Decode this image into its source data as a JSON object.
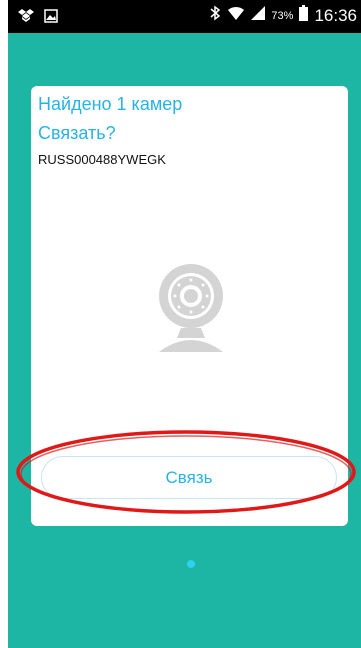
{
  "status_bar": {
    "battery_percent": "73%",
    "time": "16:36",
    "icons": [
      "dropbox-icon",
      "image-notification-icon",
      "bluetooth-icon",
      "wifi-icon",
      "signal-icon",
      "battery-icon"
    ]
  },
  "card": {
    "title_line1": "Найдено 1 камер",
    "title_line2": "Связать?",
    "serial": "RUSS000488YWEGK",
    "camera_icon": "camera-icon",
    "connect_label": "Связь"
  },
  "pager": {
    "pages": 1,
    "current": 1
  },
  "colors": {
    "background": "#1db5a4",
    "accent": "#27b3e6",
    "annotation": "#e01818"
  }
}
